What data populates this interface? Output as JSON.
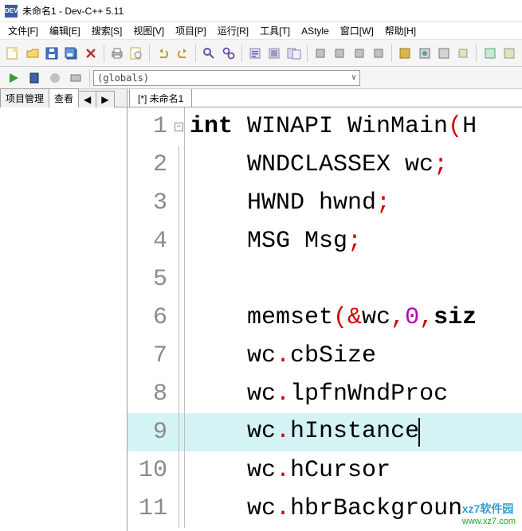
{
  "titlebar": {
    "appicon_text": "DEV",
    "title": "未命名1 - Dev-C++ 5.11"
  },
  "menus": {
    "file": "文件[F]",
    "edit": "编辑[E]",
    "search": "搜索[S]",
    "view": "视图[V]",
    "project": "项目[P]",
    "run": "运行[R]",
    "tools": "工具[T]",
    "astyle": "AStyle",
    "window": "窗口[W]",
    "help": "帮助[H]"
  },
  "globals_combo": "(globals)",
  "sidebar": {
    "tab_project": "项目管理",
    "tab_view": "查看",
    "nav_left": "◀",
    "nav_right": "▶"
  },
  "editor_tab": "[*] 未命名1",
  "code": {
    "lines": [
      {
        "n": "1",
        "tokens": [
          {
            "t": "int ",
            "c": "kw"
          },
          {
            "t": "WINAPI WinMain",
            "c": "txt"
          },
          {
            "t": "(",
            "c": "pn"
          },
          {
            "t": "H",
            "c": "txt"
          }
        ]
      },
      {
        "n": "2",
        "tokens": [
          {
            "t": "    WNDCLASSEX wc",
            "c": "txt"
          },
          {
            "t": ";",
            "c": "pn"
          }
        ]
      },
      {
        "n": "3",
        "tokens": [
          {
            "t": "    HWND hwnd",
            "c": "txt"
          },
          {
            "t": ";",
            "c": "pn"
          }
        ]
      },
      {
        "n": "4",
        "tokens": [
          {
            "t": "    MSG Msg",
            "c": "txt"
          },
          {
            "t": ";",
            "c": "pn"
          }
        ]
      },
      {
        "n": "5",
        "tokens": []
      },
      {
        "n": "6",
        "tokens": [
          {
            "t": "    memset",
            "c": "txt"
          },
          {
            "t": "(&",
            "c": "pn"
          },
          {
            "t": "wc",
            "c": "txt"
          },
          {
            "t": ",",
            "c": "pn"
          },
          {
            "t": "0",
            "c": "num"
          },
          {
            "t": ",",
            "c": "pn"
          },
          {
            "t": "siz",
            "c": "kw"
          }
        ]
      },
      {
        "n": "7",
        "tokens": [
          {
            "t": "    wc",
            "c": "txt"
          },
          {
            "t": ".",
            "c": "pn"
          },
          {
            "t": "cbSize",
            "c": "txt"
          }
        ]
      },
      {
        "n": "8",
        "tokens": [
          {
            "t": "    wc",
            "c": "txt"
          },
          {
            "t": ".",
            "c": "pn"
          },
          {
            "t": "lpfnWndProc",
            "c": "txt"
          }
        ]
      },
      {
        "n": "9",
        "tokens": [
          {
            "t": "    wc",
            "c": "txt"
          },
          {
            "t": ".",
            "c": "pn"
          },
          {
            "t": "hInstance",
            "c": "txt"
          }
        ],
        "hl": true,
        "cursor": true
      },
      {
        "n": "10",
        "tokens": [
          {
            "t": "    wc",
            "c": "txt"
          },
          {
            "t": ".",
            "c": "pn"
          },
          {
            "t": "hCursor",
            "c": "txt"
          }
        ]
      },
      {
        "n": "11",
        "tokens": [
          {
            "t": "    wc",
            "c": "txt"
          },
          {
            "t": ".",
            "c": "pn"
          },
          {
            "t": "hbrBackgroun",
            "c": "txt"
          }
        ]
      }
    ]
  },
  "watermark": {
    "line1": "xz7软件园",
    "line2": "www.xz7.com"
  }
}
